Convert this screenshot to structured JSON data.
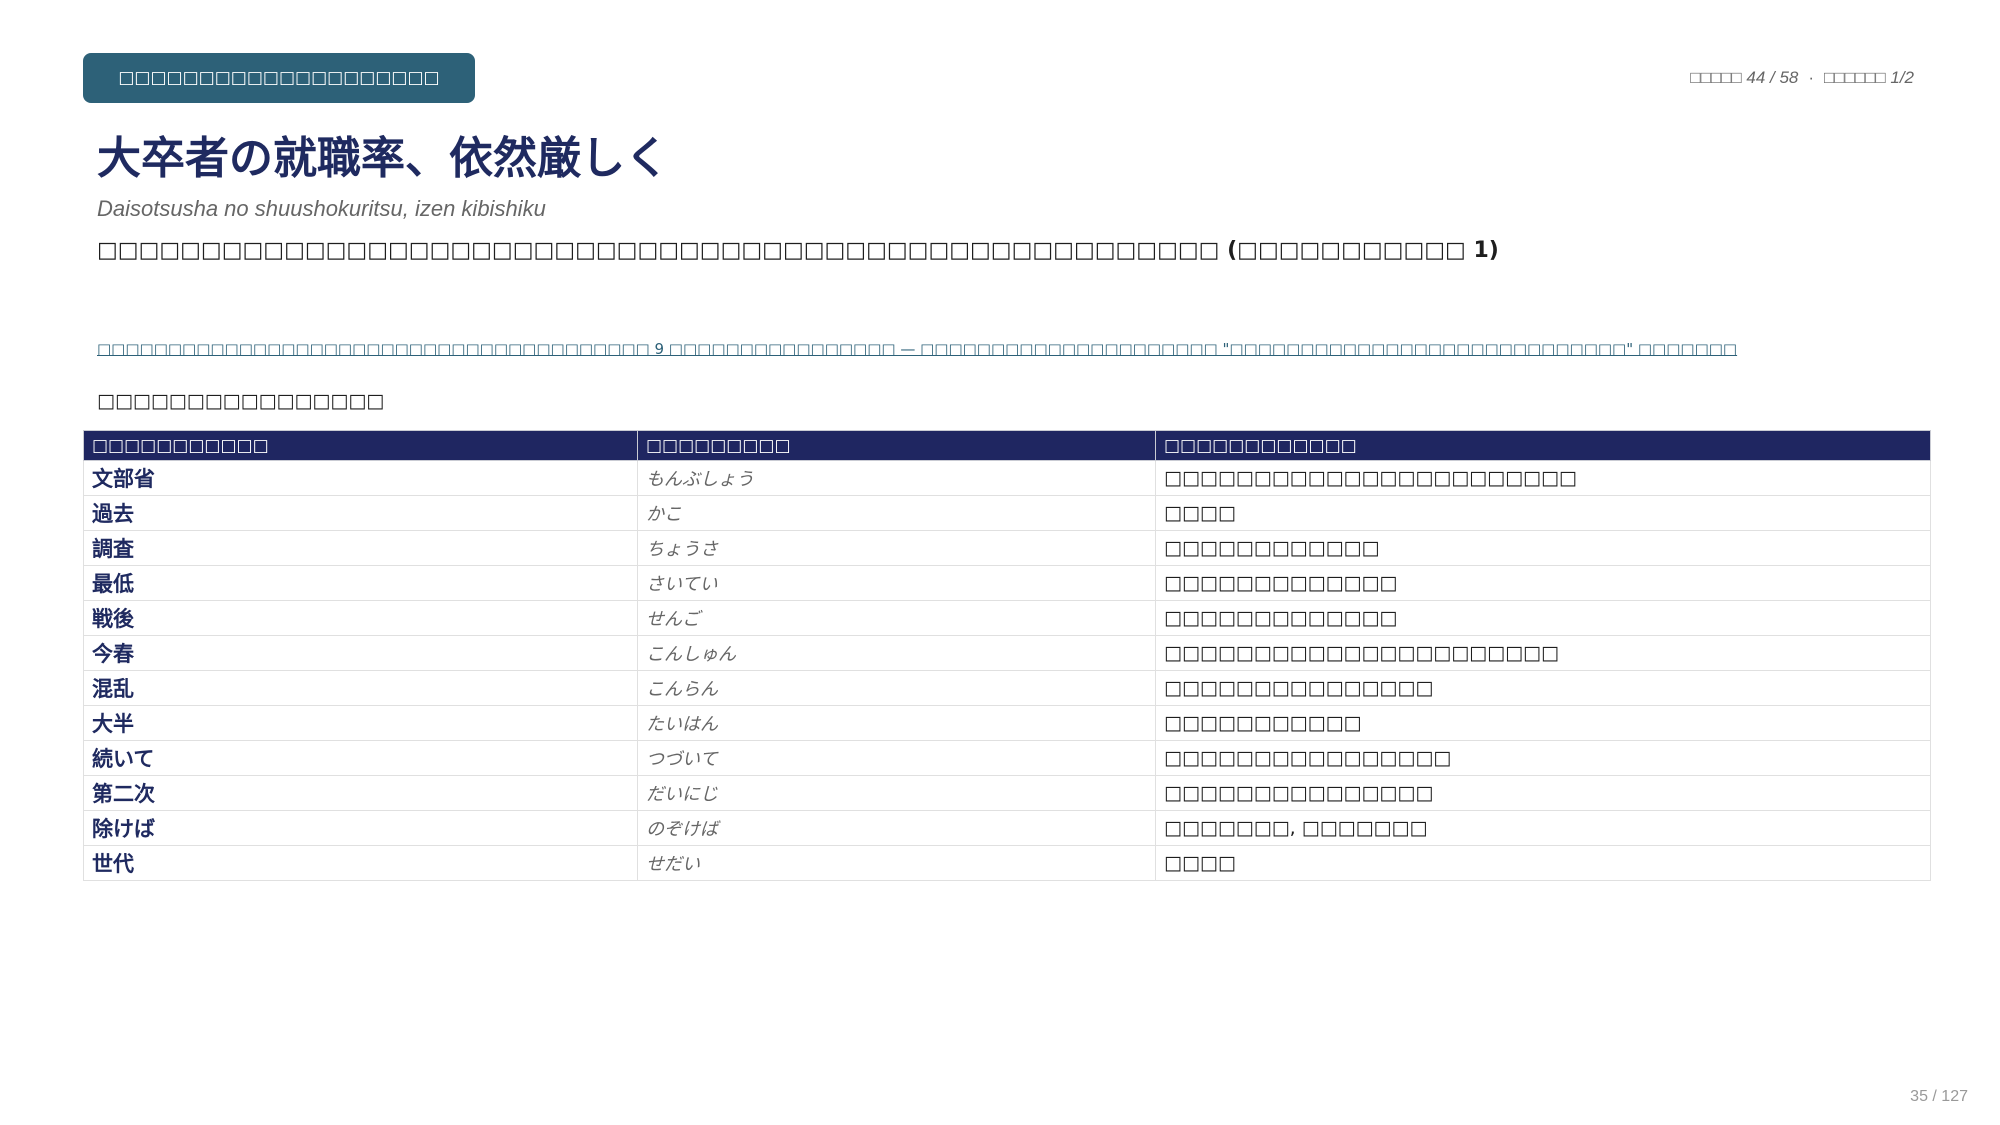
{
  "header": {
    "tag_label": "□□□□□□□□□□□□□□□□□□□□",
    "progress_a": "□□□□□ 44 / 58",
    "progress_separator": "·",
    "progress_b": "□□□□□□ 1/2"
  },
  "article": {
    "title": "大卒者の就職率、依然厳しく",
    "romaji": "Daisotsusha no shuushokuritsu, izen kibishiku",
    "summary": "□□□□□□□□□□□□□□□□□□□□□□□□□□□□□□□□□□□□□□□□□□□□□□□□□□□□□□ (□□□□□□□□□□□ 1)",
    "source_link": "□□□□□□□□□□□□□□□□□□□□□□□□□□□□□□□□□□□□□□□ 9 □□□□□□□□□□□□□□□□ — □□□□□□□□□□□□□□□□□□□□□ \"□□□□□□□□□□□□□□□□□□□□□□□□□□□□\" □□□□□□□"
  },
  "vocab": {
    "heading": "□□□□□□□□□□□□□□□□",
    "columns": [
      "□□□□□□□□□□□",
      "□□□□□□□□□",
      "□□□□□□□□□□□□"
    ],
    "rows": [
      {
        "word": "文部省",
        "reading": "もんぶしょう",
        "meaning": "□□□□□□□□□□□□□□□□□□□□□□□"
      },
      {
        "word": "過去",
        "reading": "かこ",
        "meaning": "□□□□"
      },
      {
        "word": "調査",
        "reading": "ちょうさ",
        "meaning": "□□□□□□□□□□□□"
      },
      {
        "word": "最低",
        "reading": "さいてい",
        "meaning": "□□□□□□□□□□□□□"
      },
      {
        "word": "戦後",
        "reading": "せんご",
        "meaning": "□□□□□□□□□□□□□"
      },
      {
        "word": "今春",
        "reading": "こんしゅん",
        "meaning": "□□□□□□□□□□□□□□□□□□□□□□"
      },
      {
        "word": "混乱",
        "reading": "こんらん",
        "meaning": "□□□□□□□□□□□□□□□"
      },
      {
        "word": "大半",
        "reading": "たいはん",
        "meaning": "□□□□□□□□□□□"
      },
      {
        "word": "続いて",
        "reading": "つづいて",
        "meaning": "□□□□□□□□□□□□□□□□"
      },
      {
        "word": "第二次",
        "reading": "だいにじ",
        "meaning": "□□□□□□□□□□□□□□□"
      },
      {
        "word": "除けば",
        "reading": "のぞけば",
        "meaning": "□□□□□□□, □□□□□□□"
      },
      {
        "word": "世代",
        "reading": "せだい",
        "meaning": "□□□□"
      }
    ]
  },
  "footer": {
    "page_number": "35 / 127"
  }
}
